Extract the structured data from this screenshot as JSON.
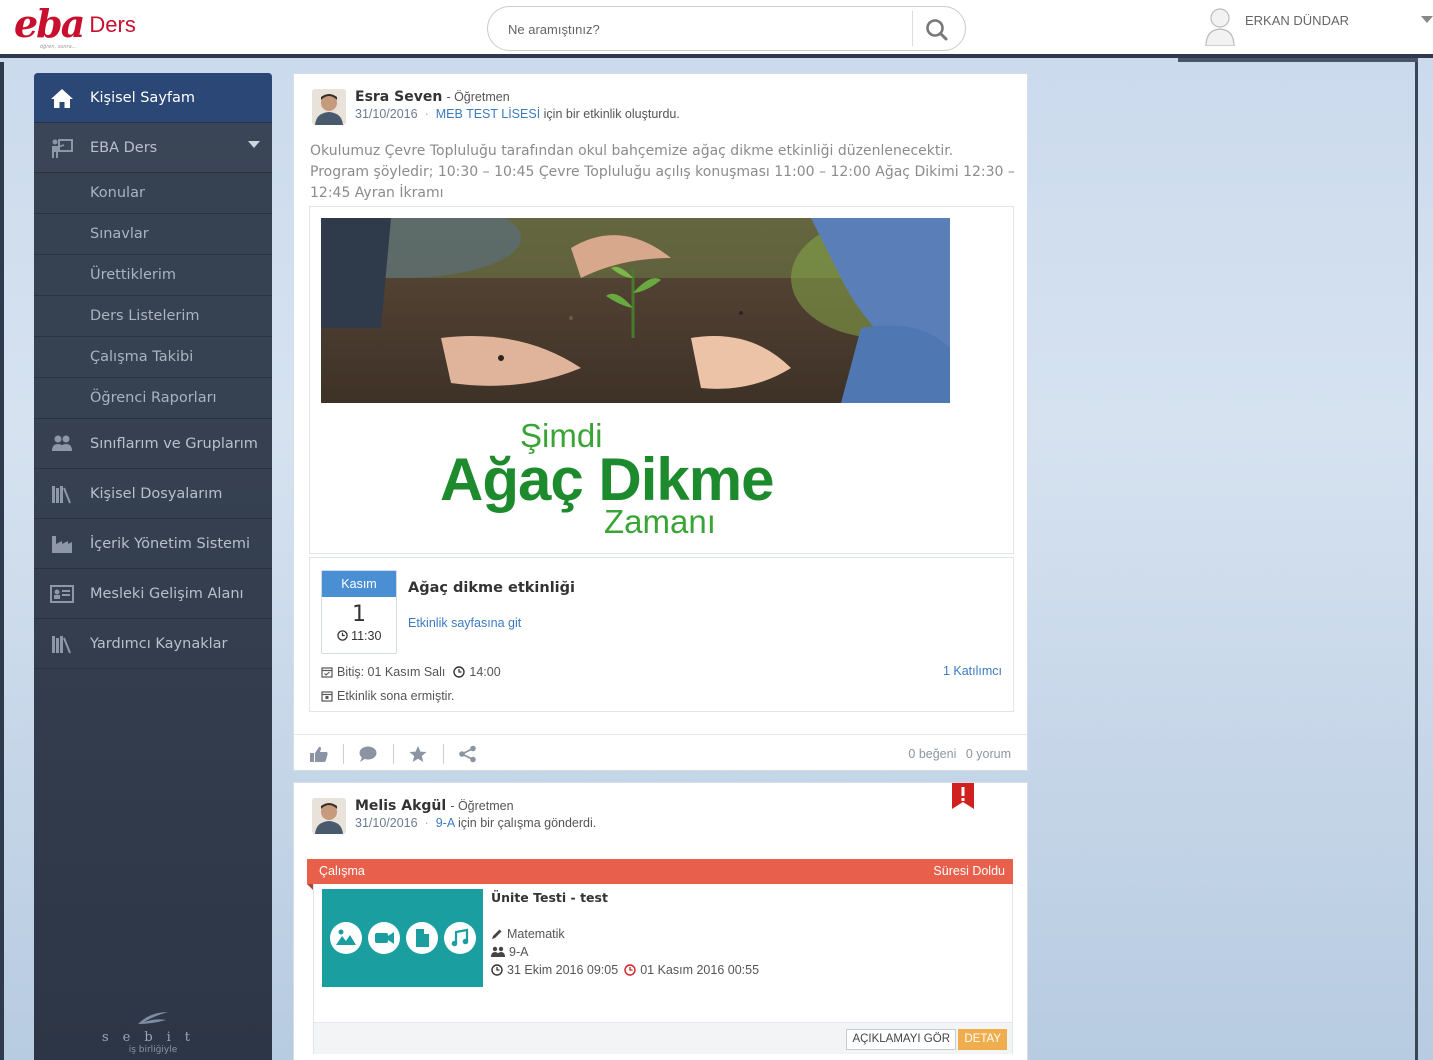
{
  "header": {
    "logo_text": "eba",
    "logo_suffix": "Ders",
    "logo_tagline": "öğren, sonra...",
    "search_placeholder": "Ne aramıştınız?",
    "user_name": "ERKAN DÜNDAR"
  },
  "sidebar": {
    "items": [
      {
        "label": "Kişisel Sayfam",
        "icon": "home-icon",
        "active": true
      },
      {
        "label": "EBA Ders",
        "icon": "presentation-icon",
        "expanded": true
      },
      {
        "label": "Sınıflarım ve Gruplarım",
        "icon": "users-icon"
      },
      {
        "label": "Kişisel Dosyalarım",
        "icon": "library-icon"
      },
      {
        "label": "İçerik Yönetim Sistemi",
        "icon": "factory-icon"
      },
      {
        "label": "Mesleki Gelişim Alanı",
        "icon": "id-card-icon"
      },
      {
        "label": "Yardımcı Kaynaklar",
        "icon": "library-icon"
      }
    ],
    "subitems": [
      "Konular",
      "Sınavlar",
      "Ürettiklerim",
      "Ders Listelerim",
      "Çalışma Takibi",
      "Öğrenci Raporları"
    ],
    "footer_brand": "sebit",
    "footer_sub": "iş birliğiyle"
  },
  "post1": {
    "author": "Esra Seven",
    "role": "- Öğretmen",
    "date": "31/10/2016",
    "target": "MEB TEST LİSESİ",
    "action": "için bir etkinlik oluşturdu.",
    "text": "Okulumuz Çevre Topluluğu tarafından okul bahçemize ağaç dikme etkinliği düzenlenecektir. Program şöyledir; 10:30 – 10:45 Çevre Topluluğu açılış konuşması 11:00 – 12:00 Ağaç Dikimi 12:30 – 12:45 Ayran İkramı",
    "poster": {
      "line1": "Şimdi",
      "line2": "Ağaç Dikme",
      "line3": "Zamanı"
    },
    "event": {
      "month": "Kasım",
      "day": "1",
      "time": "11:30",
      "title": "Ağaç dikme etkinliği",
      "link": "Etkinlik sayfasına git",
      "end_date": "Bitiş: 01 Kasım Salı",
      "end_time": "14:00",
      "status": "Etkinlik sona ermiştir.",
      "participants": "1 Katılımcı"
    },
    "likes": "0 beğeni",
    "comments": "0 yorum"
  },
  "post2": {
    "author": "Melis Akgül",
    "role": "- Öğretmen",
    "date": "31/10/2016",
    "target": "9-A",
    "action": "için bir çalışma gönderdi.",
    "task": {
      "type": "Çalışma",
      "status": "Süresi Doldu",
      "title": "Ünite Testi - test",
      "subject": "Matematik",
      "class": "9-A",
      "start": "31 Ekim 2016 09:05",
      "end": "01 Kasım 2016 00:55",
      "desc_button": "AÇIKLAMAYI GÖR",
      "detail_button": "DETAY"
    }
  },
  "colors": {
    "brand_red": "#c8102e",
    "sidebar_bg": "#3b4658",
    "active_blue": "#2a4775",
    "link_blue": "#3b7bc0",
    "task_red": "#e8604c",
    "detail_orange": "#f0ad4e",
    "thumb_teal": "#1a9ea0"
  }
}
